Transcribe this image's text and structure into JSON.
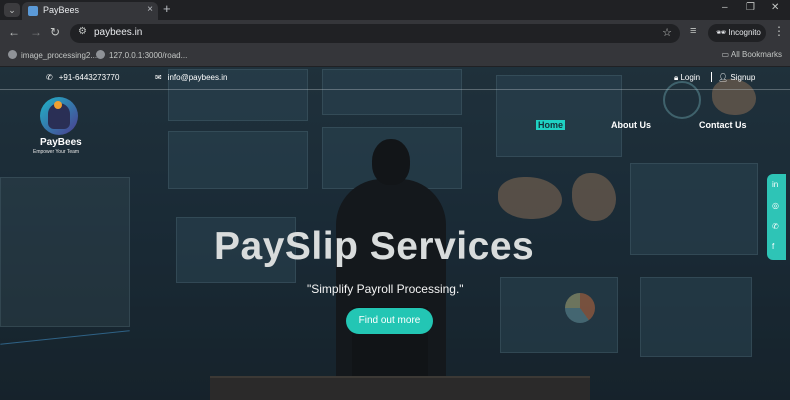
{
  "browser": {
    "tab_title": "PayBees",
    "url": "paybees.in",
    "incognito_label": "Incognito",
    "bookmarks": [
      "image_processing2...",
      "127.0.0.1:3000/road..."
    ],
    "all_bookmarks": "All Bookmarks"
  },
  "site": {
    "topbar": {
      "phone": "+91-6443273770",
      "email": "info@paybees.in",
      "login": "Login",
      "signup": "Signup"
    },
    "brand": {
      "name": "PayBees",
      "tagline": "Empower Your Team"
    },
    "nav": [
      "Home",
      "About Us",
      "Contact Us"
    ],
    "hero": {
      "title": "PaySlip Services",
      "subtitle": "\"Simplify Payroll Processing.\"",
      "cta": "Find out more"
    },
    "social": [
      "linkedin-icon",
      "instagram-icon",
      "whatsapp-icon",
      "facebook-icon"
    ],
    "colors": {
      "accent": "#23c6b4",
      "nav_active_bg": "#1fd2c3"
    }
  }
}
